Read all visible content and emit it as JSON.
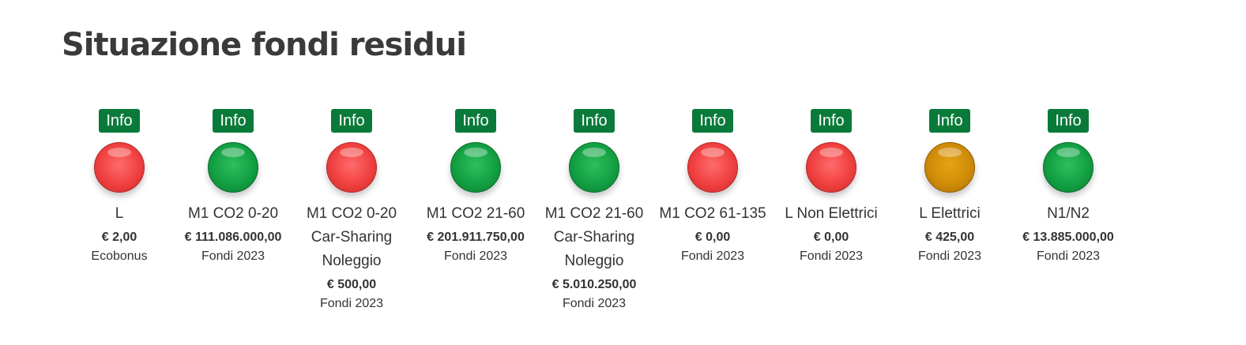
{
  "page": {
    "title": "Situazione fondi residui"
  },
  "colors": {
    "info_button": "#0a7a3a",
    "status_red": "#f04040",
    "status_green": "#13a043",
    "status_amber": "#cf8c08"
  },
  "indicators": [
    {
      "info_label": "Info",
      "status": "red",
      "label_lines": [
        "L"
      ],
      "amount": "€ 2,00",
      "subtext": "Ecobonus"
    },
    {
      "info_label": "Info",
      "status": "green",
      "label_lines": [
        "M1 CO2 0-20"
      ],
      "amount": "€ 111.086.000,00",
      "subtext": "Fondi 2023"
    },
    {
      "info_label": "Info",
      "status": "red",
      "label_lines": [
        "M1 CO2 0-20",
        "Car-Sharing",
        "Noleggio"
      ],
      "amount": "€ 500,00",
      "subtext": "Fondi 2023"
    },
    {
      "info_label": "Info",
      "status": "green",
      "label_lines": [
        "M1 CO2 21-60"
      ],
      "amount": "€ 201.911.750,00",
      "subtext": "Fondi 2023"
    },
    {
      "info_label": "Info",
      "status": "green",
      "label_lines": [
        "M1 CO2 21-60",
        "Car-Sharing",
        "Noleggio"
      ],
      "amount": "€ 5.010.250,00",
      "subtext": "Fondi 2023"
    },
    {
      "info_label": "Info",
      "status": "red",
      "label_lines": [
        "M1 CO2 61-135"
      ],
      "amount": "€ 0,00",
      "subtext": "Fondi 2023"
    },
    {
      "info_label": "Info",
      "status": "red",
      "label_lines": [
        "L Non Elettrici"
      ],
      "amount": "€ 0,00",
      "subtext": "Fondi 2023"
    },
    {
      "info_label": "Info",
      "status": "amber",
      "label_lines": [
        "L Elettrici"
      ],
      "amount": "€ 425,00",
      "subtext": "Fondi 2023"
    },
    {
      "info_label": "Info",
      "status": "green",
      "label_lines": [
        "N1/N2"
      ],
      "amount": "€ 13.885.000,00",
      "subtext": "Fondi 2023"
    }
  ]
}
